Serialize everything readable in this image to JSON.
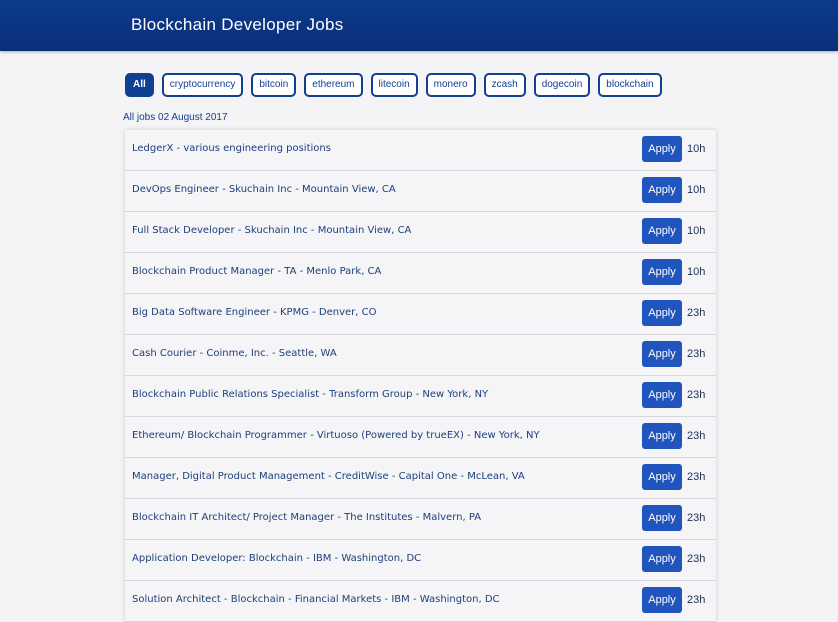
{
  "header": {
    "title": "Blockchain Developer Jobs"
  },
  "filters": [
    "All",
    "cryptocurrency",
    "bitcoin",
    "ethereum",
    "litecoin",
    "monero",
    "zcash",
    "dogecoin",
    "blockchain"
  ],
  "date_label": "All jobs 02 August 2017",
  "apply_label": "Apply",
  "jobs": [
    {
      "title": "LedgerX - various engineering positions",
      "age": "10h"
    },
    {
      "title": "DevOps Engineer - Skuchain Inc - Mountain View, CA",
      "age": "10h"
    },
    {
      "title": "Full Stack Developer - Skuchain Inc - Mountain View, CA",
      "age": "10h"
    },
    {
      "title": "Blockchain Product Manager - TA - Menlo Park, CA",
      "age": "10h"
    },
    {
      "title": "Big Data Software Engineer - KPMG - Denver, CO",
      "age": "23h"
    },
    {
      "title": "Cash Courier - Coinme, Inc. - Seattle, WA",
      "age": "23h"
    },
    {
      "title": "Blockchain Public Relations Specialist - Transform Group - New York, NY",
      "age": "23h"
    },
    {
      "title": "Ethereum/ Blockchain Programmer - Virtuoso (Powered by trueEX) - New York, NY",
      "age": "23h"
    },
    {
      "title": "Manager, Digital Product Management - CreditWise - Capital One - McLean, VA",
      "age": "23h"
    },
    {
      "title": "Blockchain IT Architect/ Project Manager - The Institutes - Malvern, PA",
      "age": "23h"
    },
    {
      "title": "Application Developer: Blockchain - IBM - Washington, DC",
      "age": "23h"
    },
    {
      "title": "Solution Architect - Blockchain - Financial Markets - IBM - Washington, DC",
      "age": "23h"
    }
  ]
}
